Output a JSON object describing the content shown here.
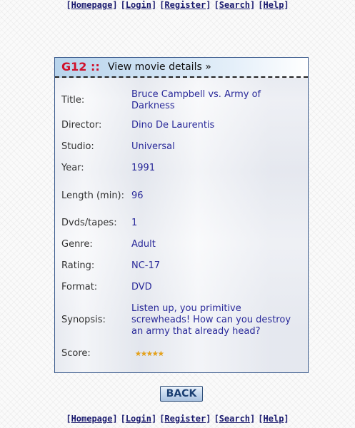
{
  "nav": {
    "links": [
      "Homepage",
      "Login",
      "Register",
      "Search",
      "Help"
    ]
  },
  "panel": {
    "code": "G12 ::",
    "title": "View movie details »"
  },
  "details": [
    {
      "label": "Title:",
      "value": "Bruce Campbell vs. Army of Darkness"
    },
    {
      "label": "Director:",
      "value": "Dino De Laurentis"
    },
    {
      "label": "Studio:",
      "value": "Universal"
    },
    {
      "label": "Year:",
      "value": "1991"
    },
    {
      "label": "Length (min):",
      "value": "96"
    },
    {
      "label": "Dvds/tapes:",
      "value": "1"
    },
    {
      "label": "Genre:",
      "value": "Adult"
    },
    {
      "label": "Rating:",
      "value": "NC-17"
    },
    {
      "label": "Format:",
      "value": "DVD"
    },
    {
      "label": "Synopsis:",
      "value": "Listen up, you primitive screwheads! How can you destroy an army that already head?"
    }
  ],
  "score": {
    "label": "Score:",
    "stars": 5,
    "max": 5,
    "color": "#e6a21a"
  },
  "back_button": "BACK",
  "colors": {
    "code": "#d0102a",
    "link": "#1a1a6e",
    "value": "#2a2a9a",
    "border": "#3a5a8c"
  }
}
